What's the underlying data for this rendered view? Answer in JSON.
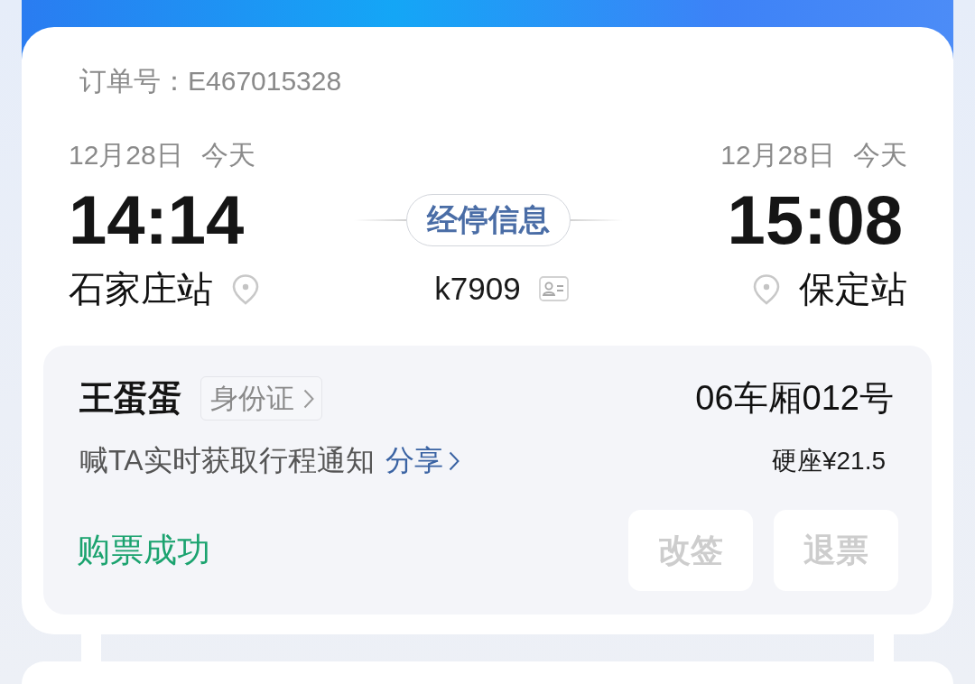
{
  "order_number": "订单号：E467015328",
  "departure": {
    "date": "12月28日",
    "day": "今天",
    "time": "14:14",
    "station": "石家庄站"
  },
  "train": {
    "stops_button": "经停信息",
    "number": "k7909"
  },
  "arrival": {
    "date": "12月28日",
    "day": "今天",
    "time": "15:08",
    "station": "保定站"
  },
  "passenger": {
    "name": "王蛋蛋",
    "id_type": "身份证",
    "seat": "06车厢012号",
    "notice": "喊TA实时获取行程通知",
    "share_link": "分享",
    "fare": "硬座¥21.5",
    "status": "购票成功",
    "actions": [
      {
        "label": "改签",
        "disabled": true
      },
      {
        "label": "退票",
        "disabled": true
      }
    ]
  }
}
